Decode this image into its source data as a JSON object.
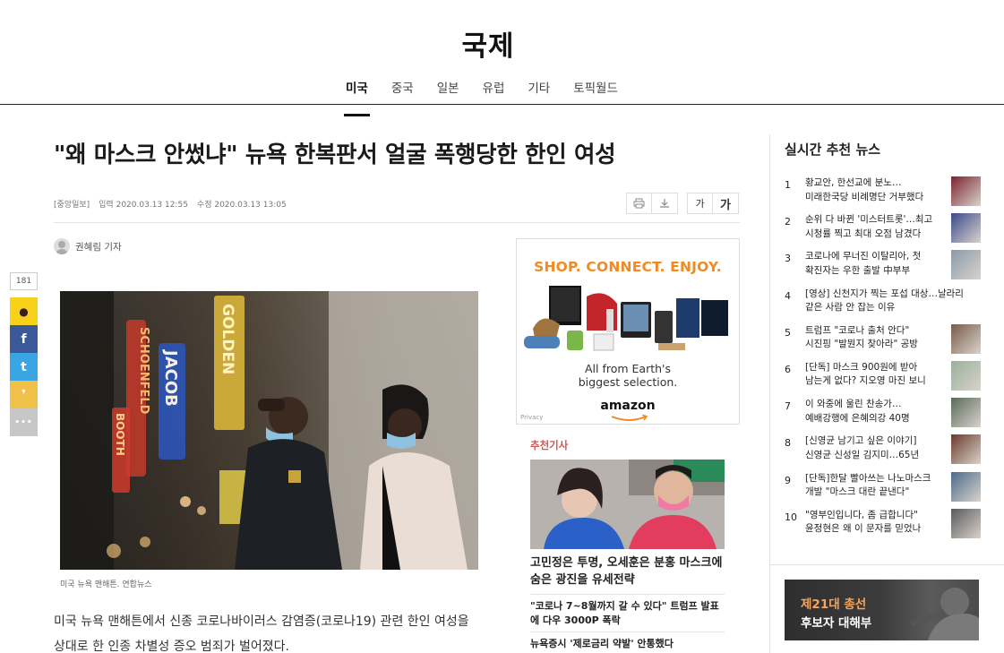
{
  "header": {
    "section_title": "국제",
    "nav": [
      "미국",
      "중국",
      "일본",
      "유럽",
      "기타",
      "토픽월드"
    ],
    "active_nav": "미국"
  },
  "article": {
    "headline": "\"왜 마스크 안썼냐\" 뉴욕 한복판서 얼굴 폭행당한 한인 여성",
    "source": "[중앙일보]",
    "published_label": "입력",
    "published": "2020.03.13 12:55",
    "updated_label": "수정",
    "updated": "2020.03.13 13:05",
    "font_small": "가",
    "font_large": "가",
    "reporter": "권혜림 기자",
    "photo_caption": "미국 뉴욕 맨해튼. 연합뉴스",
    "photo_signs": [
      "SCHOENFELD",
      "JACOB",
      "GOLDEN",
      "BOOTH"
    ],
    "body": "미국 뉴욕 맨해튼에서 신종 코로나바이러스 감염증(코로나19) 관련 한인 여성을 상대로 한 인종 차별성 증오 범죄가 벌어졌다."
  },
  "share": {
    "count": "181",
    "buttons": [
      {
        "name": "kakaotalk",
        "glyph": "●",
        "color": "#f7d21b"
      },
      {
        "name": "facebook",
        "glyph": "f",
        "color": "#3b5998"
      },
      {
        "name": "twitter",
        "glyph": "t",
        "color": "#3aa5e3"
      },
      {
        "name": "kakaostory",
        "glyph": "❜",
        "color": "#f1c24a"
      },
      {
        "name": "more",
        "glyph": "•••",
        "color": "#c7c7c7"
      }
    ]
  },
  "ad": {
    "headline": "SHOP. CONNECT. ENJOY.",
    "tagline_1": "All from Earth's",
    "tagline_2": "biggest selection.",
    "brand": "amazon",
    "privacy": "Privacy",
    "headline_color": "#f08a24"
  },
  "recommended": {
    "label": "추천기사",
    "main_title": "고민정은 투명, 오세훈은 분홍 마스크에 숨은 광진을 유세전략",
    "items": [
      "\"코로나 7~8월까지 갈 수 있다\" 트럼프 발표에 다우 3000P 폭락",
      "뉴욕증시 '제로금리 약발' 안통했다"
    ]
  },
  "sidebar": {
    "title": "실시간 추천 뉴스",
    "items": [
      {
        "rank": "1",
        "line1": "황교안, 한선교에 분노…",
        "line2": "미래한국당 비례명단 거부했다",
        "thumb": true
      },
      {
        "rank": "2",
        "line1": "순위 다 바뀐 '미스터트롯'…최고",
        "line2": "시청률 찍고 최대 오점 남겼다",
        "thumb": true
      },
      {
        "rank": "3",
        "line1": "코로나에 무너진 이탈리아, 첫",
        "line2": "확진자는 우한 출발 中부부",
        "thumb": true
      },
      {
        "rank": "4",
        "line1": "[영상] 신천지가 찍는 포섭 대상…날라리",
        "line2": "같은 사람 안 잡는 이유",
        "thumb": false
      },
      {
        "rank": "5",
        "line1": "트럼프 \"코로나 출처 안다\"",
        "line2": "시진핑 \"발뭔지 찾아라\" 공방",
        "thumb": true
      },
      {
        "rank": "6",
        "line1": "[단독] 마스크 900원에 받아",
        "line2": "남는게 없다? 지오영 마진 보니",
        "thumb": true
      },
      {
        "rank": "7",
        "line1": "이 와중에 울린 찬송가…",
        "line2": "예배강행에 은혜의강 40명",
        "thumb": true
      },
      {
        "rank": "8",
        "line1": "[신영균 남기고 싶은 이야기]",
        "line2": "신영균 신성일 김지미…65년",
        "thumb": true
      },
      {
        "rank": "9",
        "line1": "[단독]한달 빨아쓰는 나노마스크",
        "line2": "개발 \"마스크 대란 끝낸다\"",
        "thumb": true
      },
      {
        "rank": "10",
        "line1": "\"영부인입니다, 좀 급합니다\"",
        "line2": "윤정현은 왜 이 문자를 믿었나",
        "thumb": true
      }
    ],
    "banner_line1": "제21대 총선",
    "banner_line2": "후보자 대해부"
  }
}
